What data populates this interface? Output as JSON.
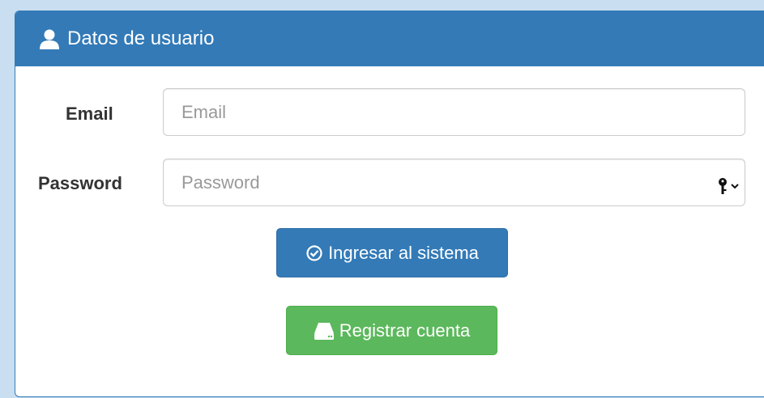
{
  "panel": {
    "title": "Datos de usuario",
    "title_icon": "user-icon"
  },
  "form": {
    "email": {
      "label": "Email",
      "placeholder": "Email",
      "value": ""
    },
    "password": {
      "label": "Password",
      "placeholder": "Password",
      "value": "",
      "autofill_icon": "key-icon"
    }
  },
  "buttons": {
    "login": {
      "label": "Ingresar al sistema",
      "icon": "check-circle-icon"
    },
    "register": {
      "label": "Registrar cuenta",
      "icon": "hard-drive-icon"
    }
  },
  "colors": {
    "primary": "#337ab7",
    "success": "#5cb85c"
  }
}
